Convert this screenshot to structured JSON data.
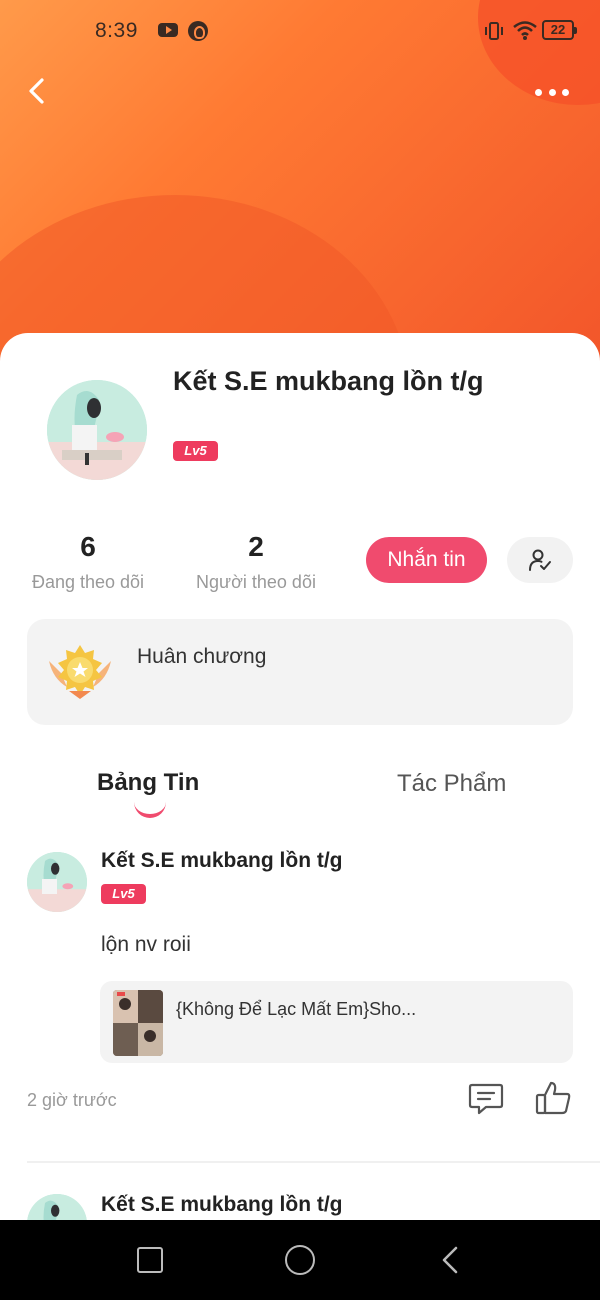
{
  "status_bar": {
    "time": "8:39",
    "battery": "22"
  },
  "profile": {
    "name": "Kết S.E mukbang lồn t/g",
    "level": "Lv5",
    "stats": [
      {
        "count": "6",
        "label": "Đang theo dõi"
      },
      {
        "count": "2",
        "label": "Người theo dõi"
      }
    ],
    "message_label": "Nhắn tin"
  },
  "medal": {
    "label": "Huân chương"
  },
  "tabs": [
    {
      "label": "Bảng Tin",
      "active": true
    },
    {
      "label": "Tác Phẩm",
      "active": false
    }
  ],
  "posts": [
    {
      "author": "Kết S.E mukbang lồn t/g",
      "level": "Lv5",
      "text": "lộn nv roii",
      "linked_title": "{Không Để Lạc Mất Em}Sho...",
      "time": "2 giờ trước"
    },
    {
      "author": "Kết S.E mukbang lồn t/g"
    }
  ],
  "colors": {
    "accent": "#f04b6e",
    "header_gradient": [
      "#ff9a4a",
      "#f2552a"
    ]
  },
  "icons": [
    "back-arrow-icon",
    "more-icon",
    "follow-user-icon",
    "medal-icon",
    "comment-icon",
    "like-icon",
    "youtube-icon",
    "vibrate-icon",
    "wifi-icon",
    "battery-icon"
  ]
}
